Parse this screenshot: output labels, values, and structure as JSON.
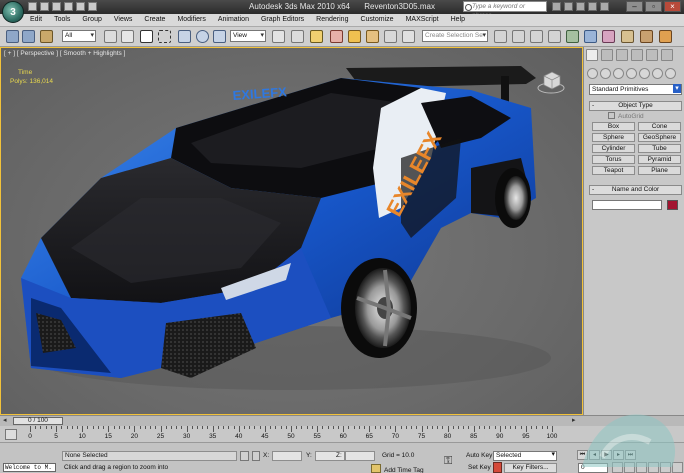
{
  "window": {
    "app_title": "Autodesk 3ds Max  2010 x64",
    "file_name": "Reventon3D05.max",
    "search_placeholder": "Type a keyword or phrase",
    "window_buttons": [
      "–",
      "▫",
      "×"
    ]
  },
  "menu": {
    "items": [
      "Edit",
      "Tools",
      "Group",
      "Views",
      "Create",
      "Modifiers",
      "Animation",
      "Graph Editors",
      "Rendering",
      "Customize",
      "MAXScript",
      "Help"
    ]
  },
  "toolbar": {
    "selection_filter": "All",
    "reference_coord": "View",
    "named_selection_placeholder": "Create Selection Se"
  },
  "viewport": {
    "label": "[ + ] [ Perspective ] [ Smooth + Highlights ]",
    "stats": {
      "time_label": "Time",
      "polys_label": "Polys:",
      "polys_value": "136,014"
    },
    "car_decal": "EXILEFX"
  },
  "command_panel": {
    "category_dropdown": "Standard Primitives",
    "object_type_title": "Object Type",
    "autogrid_label": "AutoGrid",
    "object_buttons": [
      "Box",
      "Cone",
      "Sphere",
      "GeoSphere",
      "Cylinder",
      "Tube",
      "Torus",
      "Pyramid",
      "Teapot",
      "Plane"
    ],
    "name_color_title": "Name and Color",
    "object_color": "#a21430"
  },
  "timeline": {
    "frame_indicator": "0 / 100",
    "ticks": [
      "0",
      "5",
      "10",
      "15",
      "20",
      "25",
      "30",
      "35",
      "40",
      "45",
      "50",
      "55",
      "60",
      "65",
      "70",
      "75",
      "80",
      "85",
      "90",
      "95",
      "100"
    ]
  },
  "status": {
    "listener": "Welcome to M.",
    "selection": "None Selected",
    "prompt": "Click and drag a region to zoom into",
    "x_label": "X:",
    "y_label": "Y:",
    "z_label": "Z:",
    "grid": "Grid = 10.0",
    "add_time_tag": "Add Time Tag",
    "auto_key": "Auto Key",
    "set_key": "Set Key",
    "key_mode": "Selected",
    "key_filters": "Key Filters...",
    "current_frame": "0"
  }
}
